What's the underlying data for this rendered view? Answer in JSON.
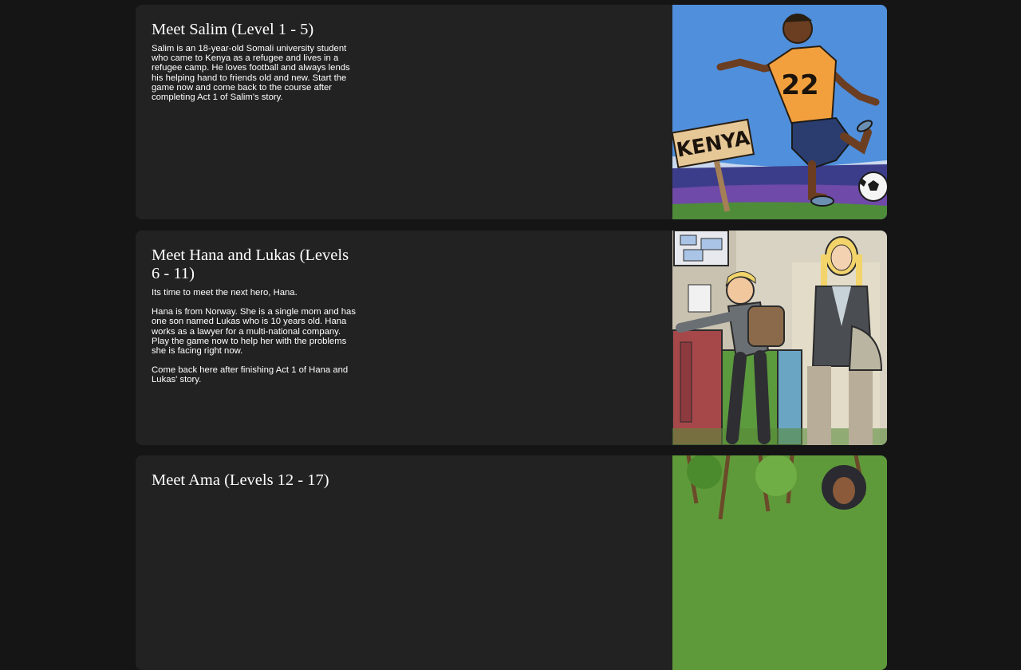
{
  "cards": [
    {
      "title": "Meet Salim (Level 1 - 5)",
      "paragraphs": [
        "Salim is an 18-year-old Somali university student who came to Kenya as a refugee and lives in a refugee camp. He loves football and always lends his helping hand to friends old and new. Start the game now and come back to the course after completing Act 1 of Salim's story."
      ],
      "image": {
        "icon": "footballer-illustration",
        "sign_text": "KENYA",
        "jersey_number": "22"
      }
    },
    {
      "title": "Meet Hana and Lukas (Levels 6 - 11)",
      "paragraphs": [
        "Its time to meet the next hero, Hana.",
        "Hana is from Norway. She is a single mom and has one son named Lukas who is 10 years old. Hana works as a lawyer for a multi-national company. Play the game now to help her with the problems she is facing right now.",
        "Come back here after finishing Act 1 of Hana and Lukas' story."
      ],
      "image": {
        "icon": "school-hallway-illustration"
      }
    },
    {
      "title": "Meet Ama (Levels 12 - 17)",
      "paragraphs": [],
      "image": {
        "icon": "forest-illustration"
      }
    }
  ],
  "colors": {
    "page_bg": "#151515",
    "card_bg": "#222222",
    "text": "#ffffff"
  }
}
